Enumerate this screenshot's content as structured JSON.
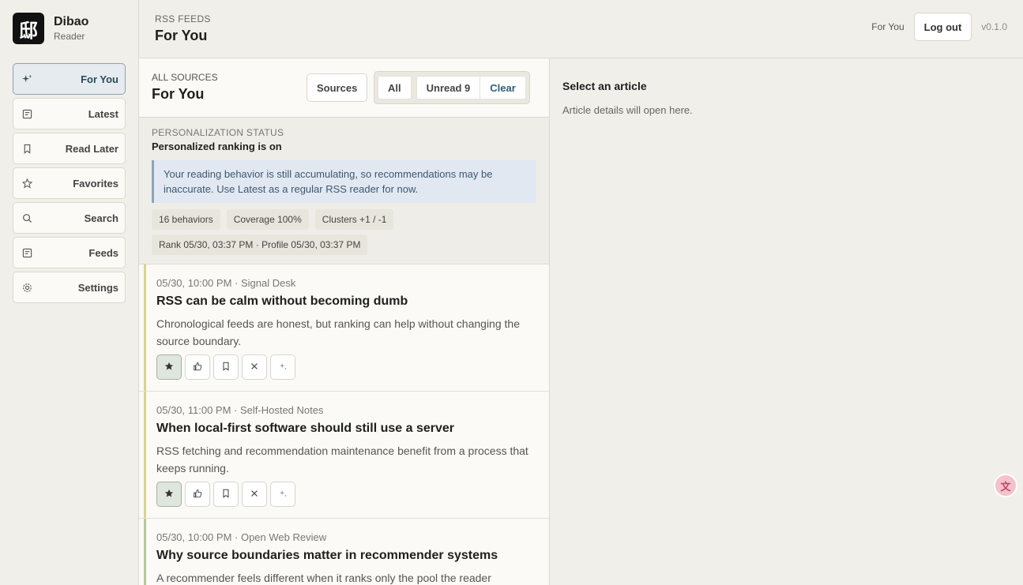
{
  "brand": {
    "name": "Dibao",
    "sub": "Reader",
    "logo_glyph": "邸"
  },
  "nav": [
    {
      "label": "For You",
      "icon": "sparkle-icon",
      "active": true
    },
    {
      "label": "Latest",
      "icon": "list-icon"
    },
    {
      "label": "Read Later",
      "icon": "bookmark-icon"
    },
    {
      "label": "Favorites",
      "icon": "star-icon"
    },
    {
      "label": "Search",
      "icon": "search-icon"
    },
    {
      "label": "Feeds",
      "icon": "list-icon"
    },
    {
      "label": "Settings",
      "icon": "gear-icon"
    }
  ],
  "topbar": {
    "eyebrow": "RSS FEEDS",
    "title": "For You",
    "link": "For You",
    "logout": "Log out",
    "version": "v0.1.0"
  },
  "feed": {
    "eyebrow": "ALL SOURCES",
    "title": "For You",
    "sources_label": "Sources",
    "filter_all": "All",
    "filter_unread": "Unread 9",
    "filter_clear": "Clear"
  },
  "status": {
    "eyebrow": "PERSONALIZATION STATUS",
    "title": "Personalized ranking is on",
    "notice": "Your reading behavior is still accumulating, so recommendations may be inaccurate. Use Latest as a regular RSS reader for now.",
    "chips": [
      "16 behaviors",
      "Coverage 100%",
      "Clusters +1 / -1",
      "Rank 05/30, 03:37 PM · Profile 05/30, 03:37 PM"
    ]
  },
  "articles": [
    {
      "meta": "05/30, 10:00 PM · Signal Desk",
      "title": "RSS can be calm without becoming dumb",
      "summary": "Chronological feeds are honest, but ranking can help without changing the source boundary."
    },
    {
      "meta": "05/30, 11:00 PM · Self-Hosted Notes",
      "title": "When local-first software should still use a server",
      "summary": "RSS fetching and recommendation maintenance benefit from a process that keeps running."
    },
    {
      "meta": "05/30, 10:00 PM · Open Web Review",
      "title": "Why source boundaries matter in recommender systems",
      "summary": "A recommender feels different when it ranks only the pool the reader"
    }
  ],
  "detail": {
    "title": "Select an article",
    "subtitle": "Article details will open here."
  },
  "colors": {
    "accent": "#2f5d7a",
    "active_nav_bg": "#e5ebee",
    "notice_bg": "#e2e8f1",
    "item_bar": "#d8d48a"
  }
}
